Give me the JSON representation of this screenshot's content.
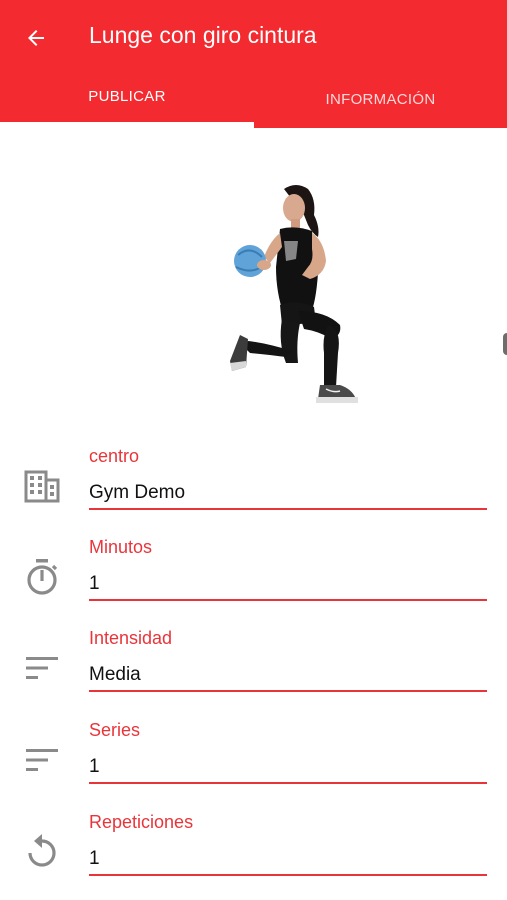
{
  "header": {
    "title": "Lunge con giro cintura",
    "back_icon": "arrow-left-icon"
  },
  "tabs": [
    {
      "label": "PUBLICAR",
      "active": true
    },
    {
      "label": "INFORMACIÓN",
      "active": false
    }
  ],
  "colors": {
    "accent": "#f32a2f",
    "label": "#e8353a",
    "icon": "#8a8a8a"
  },
  "exercise_image": {
    "icon": "lunge-figure-illustration"
  },
  "fields": [
    {
      "icon": "building-icon",
      "label": "centro",
      "value": "Gym Demo"
    },
    {
      "icon": "timer-icon",
      "label": "Minutos",
      "value": "1"
    },
    {
      "icon": "sort-lines-icon",
      "label": "Intensidad",
      "value": "Media"
    },
    {
      "icon": "sort-lines-icon",
      "label": "Series",
      "value": "1"
    },
    {
      "icon": "replay-icon",
      "label": "Repeticiones",
      "value": "1"
    }
  ]
}
